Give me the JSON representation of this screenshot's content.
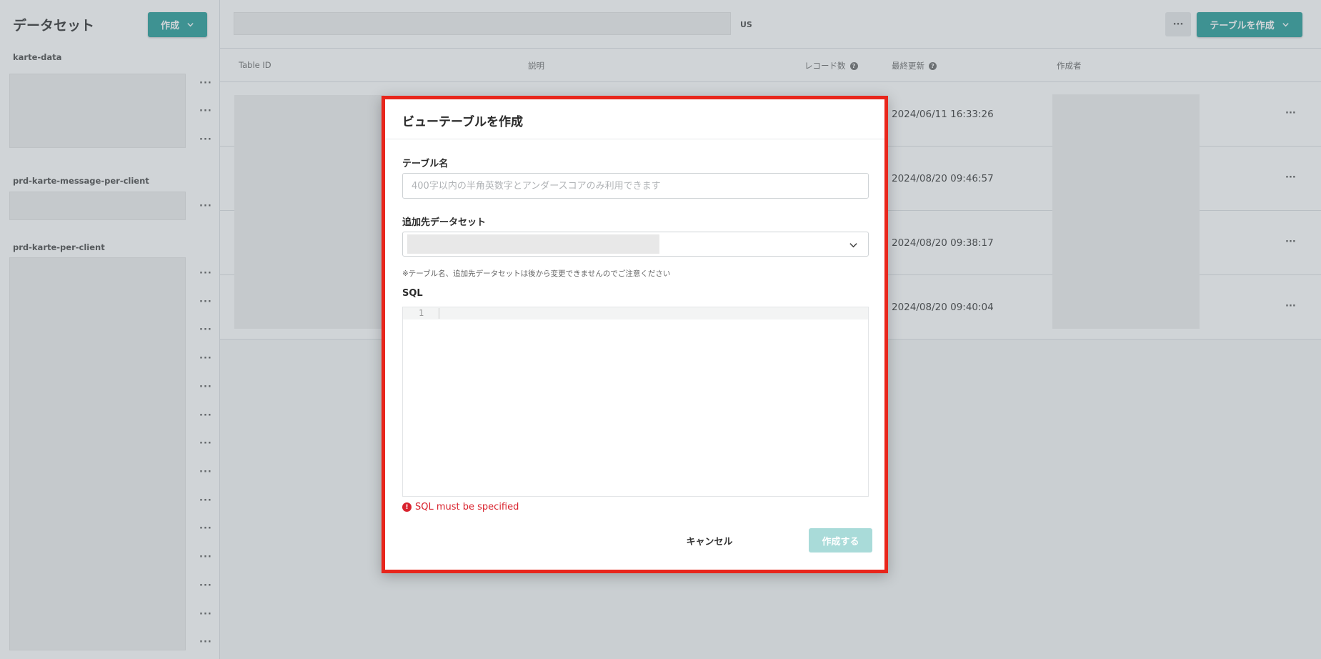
{
  "sidebar": {
    "title": "データセット",
    "create_label": "作成",
    "groups": [
      {
        "label": "karte-data"
      },
      {
        "label": "prd-karte-message-per-client"
      },
      {
        "label": "prd-karte-per-client"
      }
    ],
    "more_icon": "···"
  },
  "topbar": {
    "region": "US",
    "more_icon": "···",
    "create_table_label": "テーブルを作成"
  },
  "table": {
    "headers": {
      "table_id": "Table ID",
      "description": "説明",
      "record_count": "レコード数",
      "last_updated": "最終更新",
      "author": "作成者"
    },
    "rows": [
      {
        "last_updated": "2024/06/11 16:33:26"
      },
      {
        "last_updated": "2024/08/20 09:46:57"
      },
      {
        "last_updated": "2024/08/20 09:38:17"
      },
      {
        "last_updated": "2024/08/20 09:40:04"
      }
    ],
    "help_icon": "?",
    "row_more_icon": "···"
  },
  "modal": {
    "title": "ビューテーブルを作成",
    "table_name_label": "テーブル名",
    "table_name_placeholder": "400字以内の半角英数字とアンダースコアのみ利用できます",
    "table_name_value": "",
    "dataset_label": "追加先データセット",
    "note": "※テーブル名、追加先データセットは後から変更できませんのでご注意ください",
    "sql_label": "SQL",
    "line_number": "1",
    "error_icon": "!",
    "error_text": "SQL must be specified",
    "cancel_label": "キャンセル",
    "submit_label": "作成する"
  },
  "colors": {
    "accent": "#1f9a96",
    "highlight_border": "#e8261c",
    "error": "#d9232e"
  }
}
